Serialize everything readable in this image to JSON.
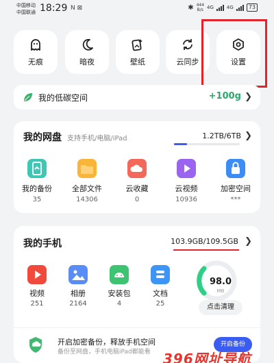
{
  "status_bar": {
    "carrier_1": "中国移动",
    "carrier_2": "中国联通",
    "time": "18:29",
    "small_indicators": "N ⊠",
    "bluetooth": "✱",
    "speed_value": "444",
    "speed_unit": "B/s",
    "net_1": "4G",
    "net_2": "4G",
    "battery": "73"
  },
  "quick_actions": [
    {
      "label": "无痕",
      "icon": "ghost-icon"
    },
    {
      "label": "暗夜",
      "icon": "moon-icon"
    },
    {
      "label": "壁纸",
      "icon": "wallpaper-icon"
    },
    {
      "label": "云同步",
      "icon": "sync-icon"
    },
    {
      "label": "设置",
      "icon": "settings-icon"
    }
  ],
  "low_carbon": {
    "label": "我的低碳空间",
    "value": "+100g"
  },
  "cloud_drive": {
    "title": "我的网盘",
    "subtitle": "支持手机/电脑/iPad",
    "usage": "1.2TB/6TB",
    "usage_fraction": 0.2,
    "items": [
      {
        "label": "我的备份",
        "count": "35",
        "icon": "backup-icon",
        "color": "#3fc7b6"
      },
      {
        "label": "全部文件",
        "count": "14306",
        "icon": "folder-icon",
        "color": "#f9b43a"
      },
      {
        "label": "云收藏",
        "count": "0",
        "icon": "cloud-favorite-icon",
        "color": "#f2685a"
      },
      {
        "label": "云视频",
        "count": "10936",
        "icon": "cloud-video-icon",
        "color": "#9b64f0"
      },
      {
        "label": "加密空间",
        "count": "***",
        "icon": "lock-icon",
        "color": "#3d8cf5"
      }
    ]
  },
  "my_phone": {
    "title": "我的手机",
    "usage": "103.9GB/109.5GB",
    "items": [
      {
        "label": "视频",
        "count": "251",
        "icon": "video-icon",
        "color": "#f04a3c"
      },
      {
        "label": "相册",
        "count": "2164",
        "icon": "album-icon",
        "color": "#5a8cf5"
      },
      {
        "label": "安装包",
        "count": "4",
        "icon": "android-package-icon",
        "color": "#3ec373"
      },
      {
        "label": "文档",
        "count": "25",
        "icon": "document-icon",
        "color": "#3d95f5"
      }
    ],
    "gauge_value": "98.0",
    "gauge_unit": "MB",
    "clean_button": "点击清理",
    "banner_title": "开启加密备份，释放手机空间",
    "banner_sub": "备份至网盘，手机电脑iPad都能看",
    "banner_button": "开启备份"
  },
  "chevron": "❯",
  "watermark": "396网址导航"
}
